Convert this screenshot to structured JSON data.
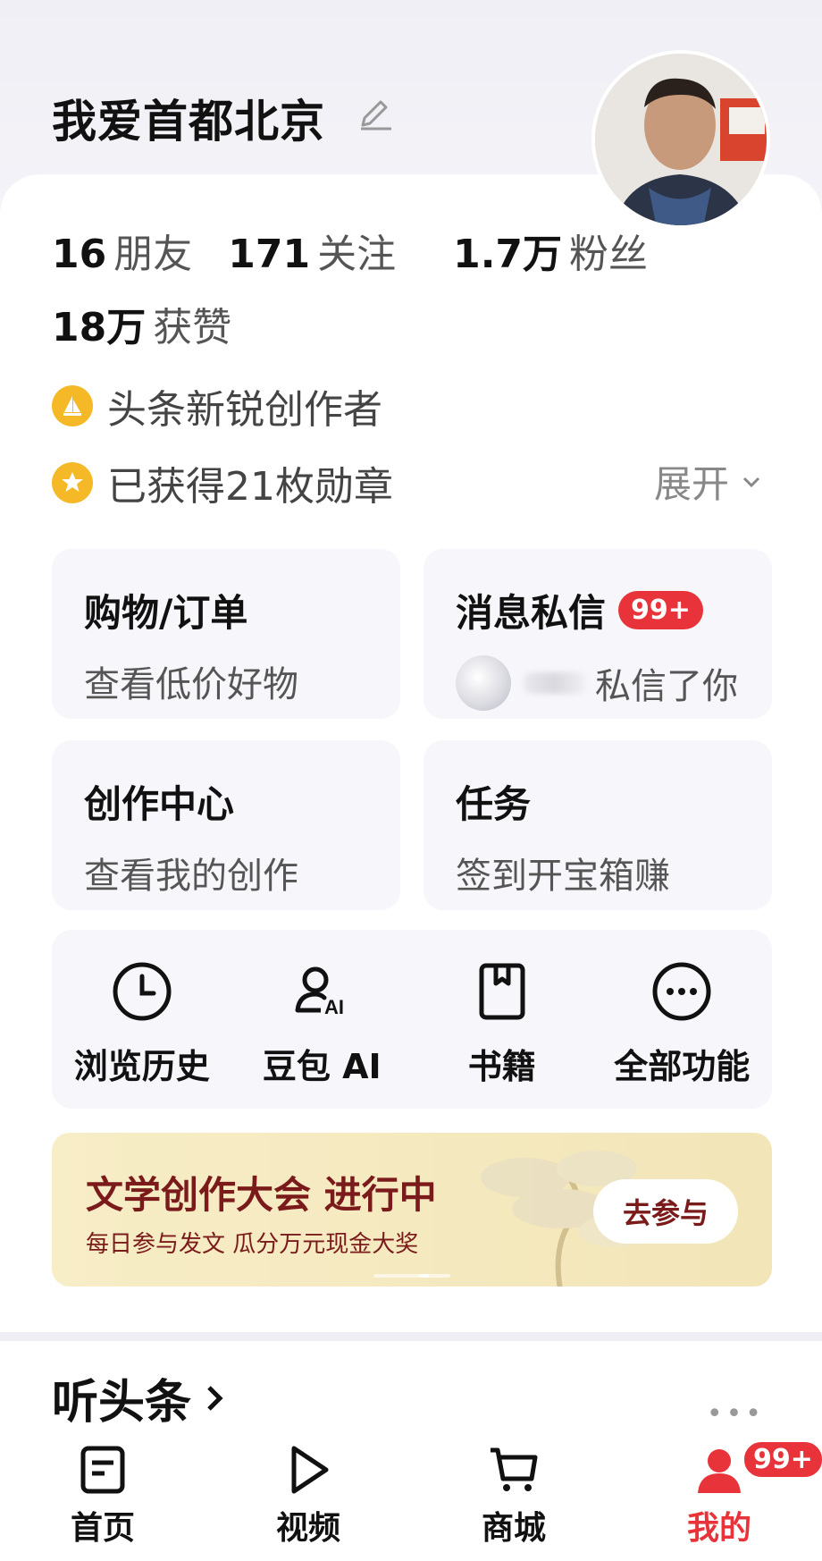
{
  "profile": {
    "username": "我爱首都北京",
    "friends": {
      "num": "16",
      "label": "朋友"
    },
    "following": {
      "num": "171",
      "label": "关注"
    },
    "followers": {
      "num": "1.7万",
      "label": "粉丝"
    },
    "likes": {
      "num": "18万",
      "label": "获赞"
    },
    "badge_creator": "头条新锐创作者",
    "badge_medals": "已获得21枚勋章",
    "expand_label": "展开"
  },
  "tiles": {
    "shopping": {
      "title": "购物/订单",
      "sub": "查看低价好物"
    },
    "messages": {
      "title": "消息私信",
      "badge": "99+",
      "sub": "私信了你"
    },
    "creation": {
      "title": "创作中心",
      "sub": "查看我的创作"
    },
    "tasks": {
      "title": "任务",
      "sub": "签到开宝箱赚"
    }
  },
  "tools": [
    {
      "label": "浏览历史",
      "icon": "clock-icon"
    },
    {
      "label": "豆包 AI",
      "icon": "doubao-ai-icon"
    },
    {
      "label": "书籍",
      "icon": "book-icon"
    },
    {
      "label": "全部功能",
      "icon": "more-circle-icon"
    }
  ],
  "banner": {
    "title": "文学创作大会 进行中",
    "subtitle": "每日参与发文 瓜分万元现金大奖",
    "button": "去参与"
  },
  "listen": {
    "title": "听头条"
  },
  "tabbar": {
    "home": "首页",
    "video": "视频",
    "mall": "商城",
    "mine": "我的",
    "mine_badge": "99+"
  },
  "colors": {
    "accent": "#e8333b",
    "badge_gold": "#f5b928",
    "banner_text": "#7a1a1a"
  }
}
